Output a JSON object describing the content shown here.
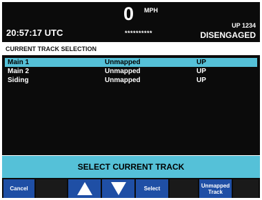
{
  "header": {
    "speed_value": "0",
    "speed_unit": "MPH",
    "time": "20:57:17 UTC",
    "masked_field": "**********",
    "train_id": "UP 1234",
    "status": "DISENGAGED"
  },
  "section": {
    "title": "CURRENT  TRACK SELECTION"
  },
  "tracks": [
    {
      "name": "Main 1",
      "mapping": "Unmapped",
      "direction": "UP",
      "selected": true
    },
    {
      "name": "Main 2",
      "mapping": "Unmapped",
      "direction": "UP",
      "selected": false
    },
    {
      "name": "Siding",
      "mapping": "Unmapped",
      "direction": "UP",
      "selected": false
    }
  ],
  "banner": {
    "text": "SELECT CURRENT TRACK"
  },
  "softkeys": {
    "cancel": "Cancel",
    "up_icon": "up-arrow-icon",
    "down_icon": "down-arrow-icon",
    "select": "Select",
    "unmapped_line1": "Unmapped",
    "unmapped_line2": "Track"
  },
  "colors": {
    "background": "#0b0b0b",
    "accent": "#55c1d8",
    "softkey": "#1f4fa5",
    "text": "#ffffff"
  }
}
